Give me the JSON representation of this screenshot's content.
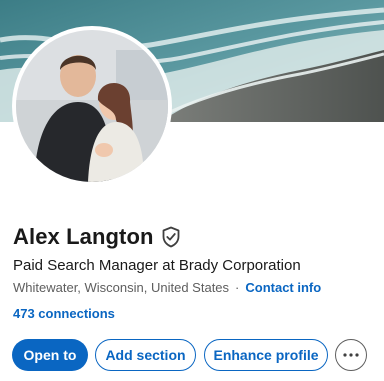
{
  "profile": {
    "name": "Alex Langton",
    "headline": "Paid Search Manager at Brady Corporation",
    "location": "Whitewater, Wisconsin, United States",
    "separator": "·",
    "contact_label": "Contact info",
    "connections": "473 connections"
  },
  "actions": {
    "open_to": "Open to",
    "add_section": "Add section",
    "enhance_profile": "Enhance profile",
    "more": "···"
  },
  "icons": {
    "verified": "shield-check-icon",
    "more": "more-horizontal-icon"
  },
  "colors": {
    "accent": "#0a66c2",
    "text_primary": "#191919",
    "text_secondary": "#5e5e5e"
  }
}
